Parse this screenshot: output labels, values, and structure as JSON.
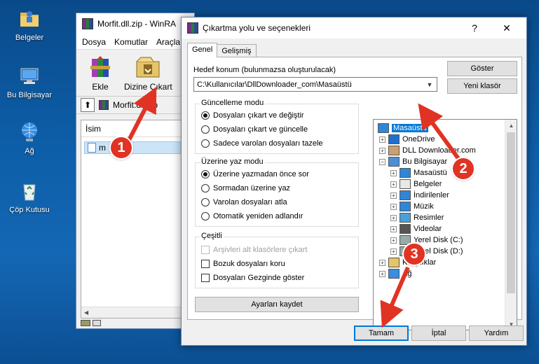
{
  "desktop": {
    "icons": [
      {
        "label": "Belgeler",
        "icon": "documents-folder-icon"
      },
      {
        "label": "Bu Bilgisayar",
        "icon": "computer-icon"
      },
      {
        "label": "Ağ",
        "icon": "network-icon"
      },
      {
        "label": "Çöp Kutusu",
        "icon": "recycle-bin-icon"
      }
    ]
  },
  "rar_window": {
    "title": "Morfit.dll.zip - WinRA",
    "menu": [
      "Dosya",
      "Komutlar",
      "Araçla"
    ],
    "toolbar": {
      "add": "Ekle",
      "extract_to": "Dizine Çıkart"
    },
    "path": "Morfit.dll.zip",
    "column_name": "İsim",
    "selected_file": "m"
  },
  "dialog": {
    "title": "Çıkartma yolu ve seçenekleri",
    "help_button": "?",
    "close_button": "✕",
    "tabs": [
      "Genel",
      "Gelişmiş"
    ],
    "dest_label": "Hedef konum (bulunmazsa oluşturulacak)",
    "dest_value": "C:\\Kullanıcılar\\DllDownloader_com\\Masaüstü",
    "show_button": "Göster",
    "new_folder_button": "Yeni klasör",
    "update_mode": {
      "title": "Güncelleme modu",
      "options": [
        "Dosyaları çıkart ve değiştir",
        "Dosyaları çıkart ve güncelle",
        "Sadece varolan dosyaları tazele"
      ],
      "selected": 0
    },
    "overwrite_mode": {
      "title": "Üzerine yaz modu",
      "options": [
        "Üzerine yazmadan önce sor",
        "Sormadan üzerine yaz",
        "Varolan dosyaları atla",
        "Otomatik yeniden adlandır"
      ],
      "selected": 0
    },
    "misc": {
      "title": "Çeşitli",
      "options": [
        {
          "label": "Arşivleri alt klasörlere çıkart",
          "checked": false,
          "disabled": true
        },
        {
          "label": "Bozuk dosyaları koru",
          "checked": false,
          "disabled": false
        },
        {
          "label": "Dosyaları Gezginde göster",
          "checked": false,
          "disabled": false
        }
      ]
    },
    "save_settings_button": "Ayarları kaydet",
    "tree": [
      {
        "label": "Masaüstü",
        "level": 0,
        "expander": "",
        "selected": true,
        "icon": "desktop-icon"
      },
      {
        "label": "OneDrive",
        "level": 1,
        "expander": "+",
        "selected": false,
        "icon": "onedrive-cloud-icon"
      },
      {
        "label": "DLL Downloader.com",
        "level": 1,
        "expander": "+",
        "selected": false,
        "icon": "user-icon"
      },
      {
        "label": "Bu Bilgisayar",
        "level": 1,
        "expander": "−",
        "selected": false,
        "icon": "computer-icon"
      },
      {
        "label": "Masaüstü",
        "level": 2,
        "expander": "+",
        "selected": false,
        "icon": "desktop-icon"
      },
      {
        "label": "Belgeler",
        "level": 2,
        "expander": "+",
        "selected": false,
        "icon": "documents-icon"
      },
      {
        "label": "İndirilenler",
        "level": 2,
        "expander": "+",
        "selected": false,
        "icon": "downloads-icon"
      },
      {
        "label": "Müzik",
        "level": 2,
        "expander": "+",
        "selected": false,
        "icon": "music-icon"
      },
      {
        "label": "Resimler",
        "level": 2,
        "expander": "+",
        "selected": false,
        "icon": "pictures-icon"
      },
      {
        "label": "Videolar",
        "level": 2,
        "expander": "+",
        "selected": false,
        "icon": "videos-icon"
      },
      {
        "label": "Yerel Disk (C:)",
        "level": 2,
        "expander": "+",
        "selected": false,
        "icon": "disk-icon"
      },
      {
        "label": "Yerel Disk (D:)",
        "level": 2,
        "expander": "+",
        "selected": false,
        "icon": "disk-icon"
      },
      {
        "label": "Kitaplıklar",
        "level": 1,
        "expander": "+",
        "selected": false,
        "icon": "libraries-icon"
      },
      {
        "label": "Ağ",
        "level": 1,
        "expander": "+",
        "selected": false,
        "icon": "network-icon"
      }
    ],
    "ok_button": "Tamam",
    "cancel_button": "İptal",
    "help_text_button": "Yardım"
  },
  "annotations": {
    "step1": "1",
    "step2": "2",
    "step3": "3",
    "color": "#e03324"
  }
}
